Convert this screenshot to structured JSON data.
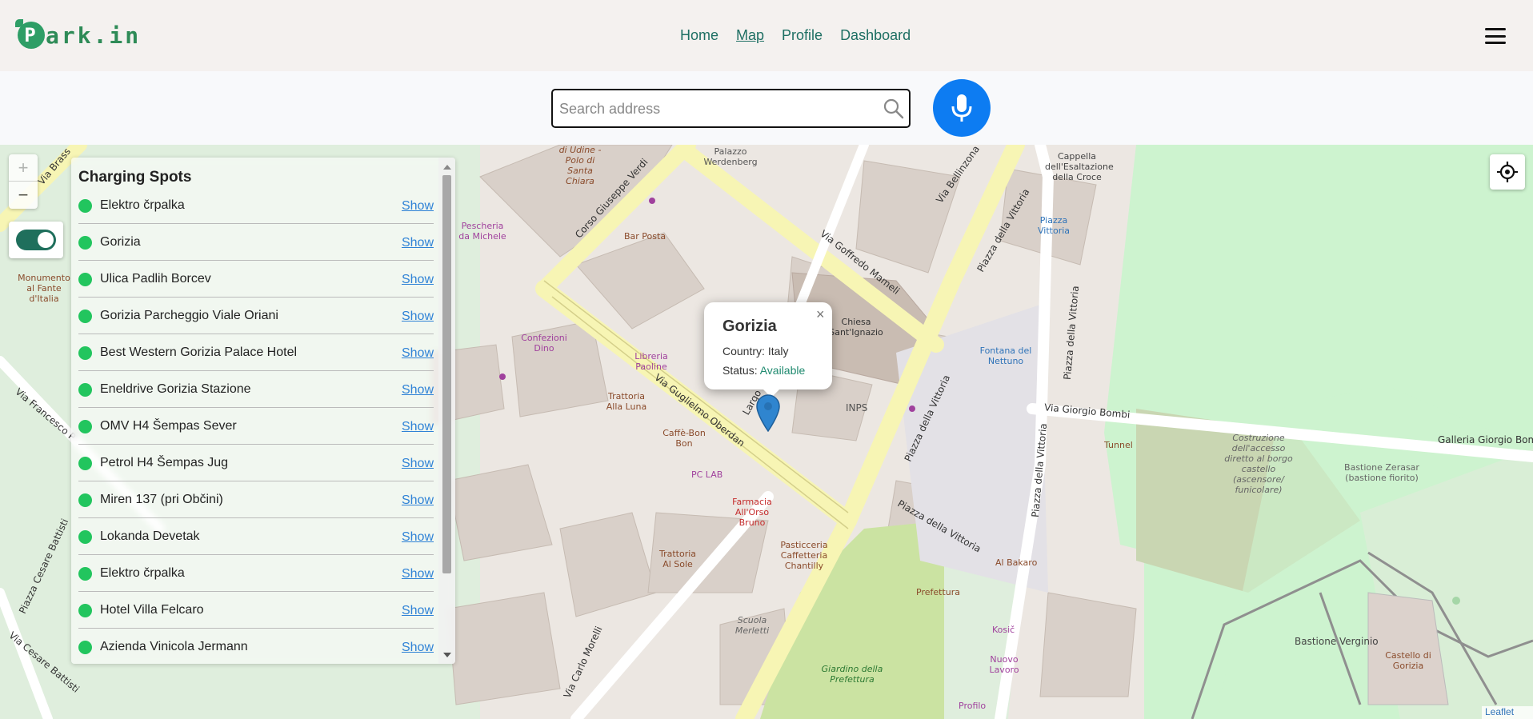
{
  "header": {
    "logo_text": "ark.in",
    "logo_letter": "P",
    "nav": [
      {
        "label": "Home",
        "active": false
      },
      {
        "label": "Map",
        "active": true
      },
      {
        "label": "Profile",
        "active": false
      },
      {
        "label": "Dashboard",
        "active": false
      }
    ]
  },
  "search": {
    "placeholder": "Search address",
    "value": ""
  },
  "map": {
    "zoom_in": "+",
    "zoom_out": "−",
    "attribution": "Leaflet",
    "labels": {
      "monument": "Monumento al Fante d'Italia",
      "via_goffredo": "Via Goffredo Mameli",
      "piazza_vittoria": "Piazza della Vittoria",
      "via_oberdan": "Via Guglielmo Oberdan",
      "via_verdi": "Corso Giuseppe Verdi",
      "chiesa": "Chiesa Sant'Ignazio",
      "inps": "INPS",
      "fontana": "Fontana del Nettuno",
      "via_bombi": "Via Giorgio Bombi",
      "galleria": "Galleria Giorgio Bombi",
      "bastione_z": "Bastione Zerasar (bastione fiorito)",
      "costruzione": "Costruzione dell'accesso diretto al borgo castello (ascensore/ funicolare)",
      "bastione_v": "Bastione Verginio",
      "castello": "Castello di Gorizia",
      "giardino": "Giardino della Prefettura",
      "prefettura": "Prefettura",
      "farmacia": "Farmacia All'Orso Bruno",
      "pasticceria": "Pasticceria Caffetteria Chantilly",
      "trattoria_sole": "Trattoria Al Sole",
      "trattoria_luna": "Trattoria Alla Luna",
      "caffe_bon": "Caffè-Bon Bon",
      "pc_lab": "PC LAB",
      "libreria": "Libreria Paoline",
      "bar_posta": "Bar Posta",
      "pescheria": "Pescheria da Michele",
      "confezioni": "Confezioni Dino",
      "palazzo": "Palazzo Werdenberg",
      "cappella": "Cappella dell'Esaltazione della Croce",
      "piazza_vittoria_blue": "Piazza Vittoria",
      "tunnel": "Tunnel",
      "al_bakaro": "Al Bakaro",
      "kosic": "Kosič",
      "nuovo_lavoro": "Nuovo Lavoro",
      "profilo": "Profilo",
      "scuola": "Scuola Merletti",
      "via_bellinzona": "Via Bellinzona",
      "via_carlo": "Via Carlo Morelli",
      "via_francesco": "Via Francesco P",
      "piazza_cesare": "Piazza Cesare Battisti",
      "via_cesare": "Via Cesare Battisti",
      "via_brass": "Via Brass",
      "largo": "Largo V",
      "udine": "di Udine - Polo di Santa Chiara"
    }
  },
  "panel": {
    "title": "Charging Spots",
    "show_label": "Show",
    "spots": [
      "Elektro črpalka",
      "Gorizia",
      "Ulica Padlih Borcev",
      "Gorizia Parcheggio Viale Oriani",
      "Best Western Gorizia Palace Hotel",
      "Eneldrive Gorizia Stazione",
      "OMV H4 Šempas Sever",
      "Petrol H4 Šempas Jug",
      "Miren 137 (pri Občini)",
      "Lokanda Devetak",
      "Elektro črpalka",
      "Hotel Villa Felcaro",
      "Azienda Vinicola Jermann"
    ]
  },
  "popup": {
    "title": "Gorizia",
    "country_label": "Country:",
    "country": "Italy",
    "status_label": "Status:",
    "status": "Available",
    "close": "×"
  },
  "colors": {
    "brand": "#2e8b57",
    "nav": "#1e6f63",
    "mic": "#0d7cf2",
    "available_dot": "#22c55e",
    "link": "#2f82d6"
  }
}
